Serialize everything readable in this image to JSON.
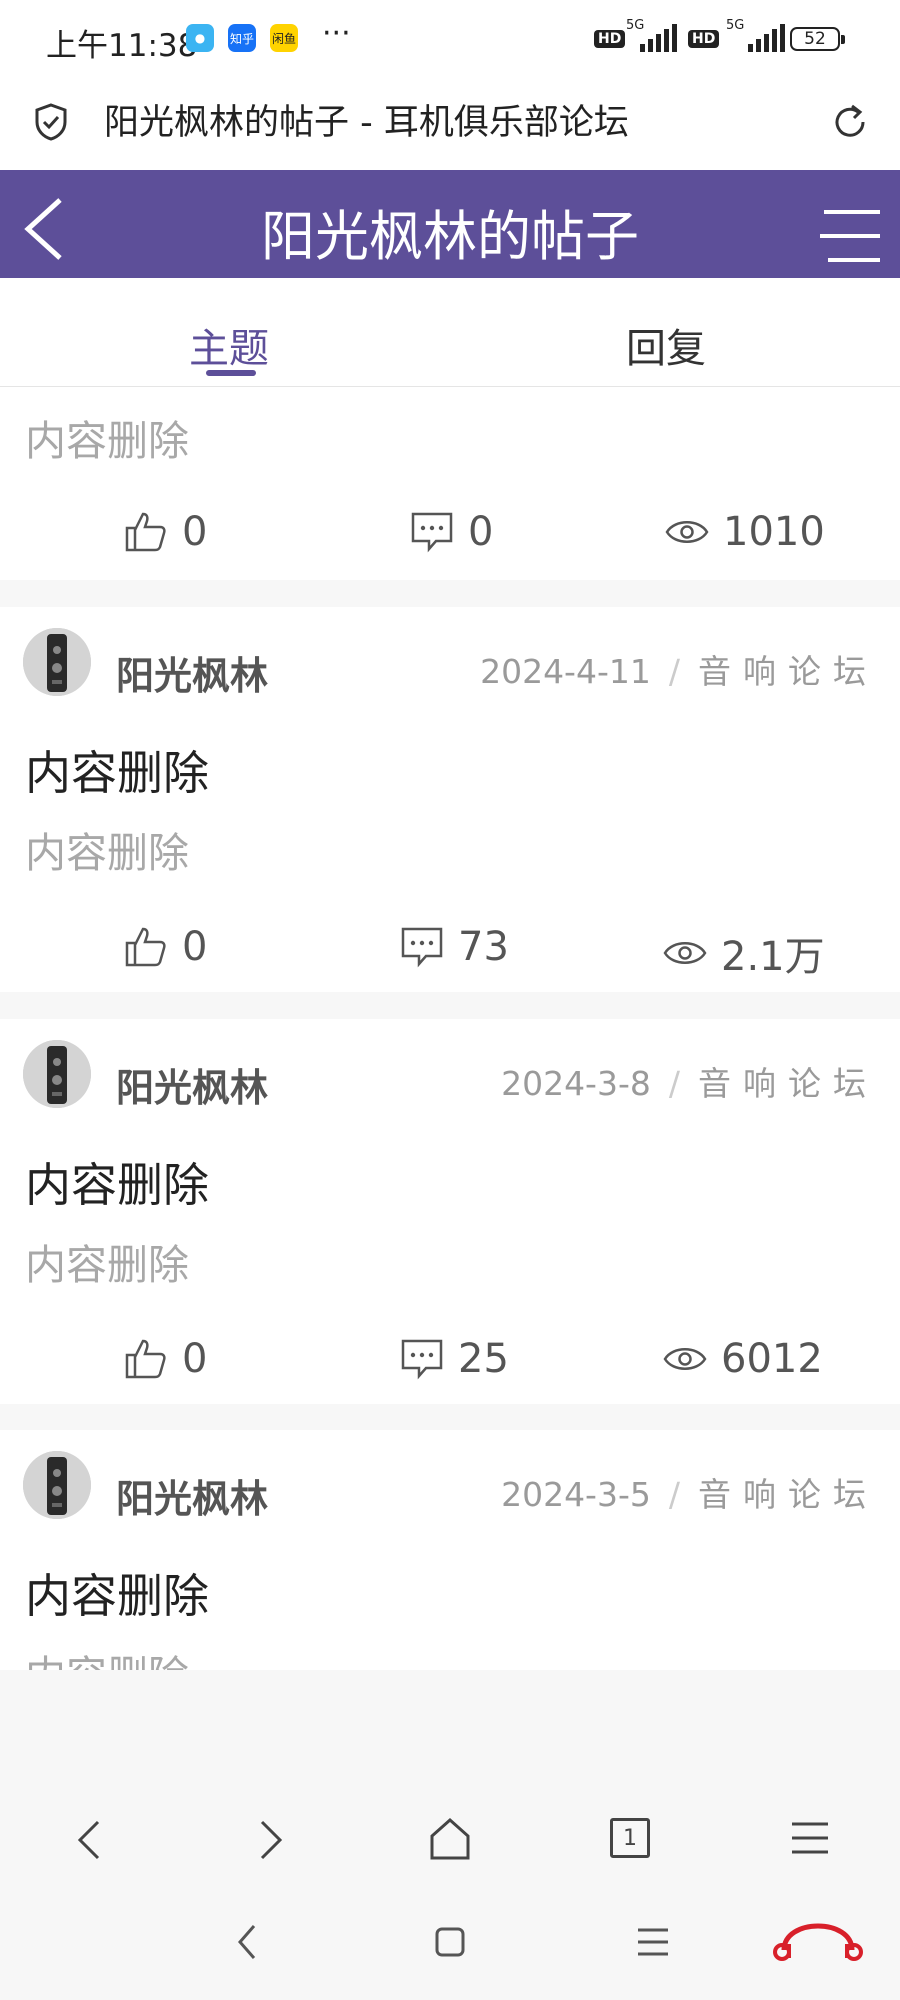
{
  "status_bar": {
    "time": "上午11:38",
    "apps": [
      "知乎",
      "闲鱼"
    ],
    "more": "···",
    "hd": "HD",
    "network": "5G",
    "battery": "52"
  },
  "browser": {
    "page_title": "阳光枫林的帖子 - 耳机俱乐部论坛"
  },
  "header": {
    "title": "阳光枫林的帖子"
  },
  "tabs": [
    {
      "label": "主题",
      "active": true
    },
    {
      "label": "回复",
      "active": false
    }
  ],
  "posts": [
    {
      "excerpt": "内容删除",
      "likes": "0",
      "comments": "0",
      "views": "1010"
    },
    {
      "author": "阳光枫林",
      "date": "2024-4-11",
      "forum": "音响论坛",
      "title": "内容删除",
      "excerpt": "内容删除",
      "likes": "0",
      "comments": "73",
      "views": "2.1万"
    },
    {
      "author": "阳光枫林",
      "date": "2024-3-8",
      "forum": "音响论坛",
      "title": "内容删除",
      "excerpt": "内容删除",
      "likes": "0",
      "comments": "25",
      "views": "6012"
    },
    {
      "author": "阳光枫林",
      "date": "2024-3-5",
      "forum": "音响论坛",
      "title": "内容删除",
      "excerpt": "内容删除"
    }
  ],
  "browser_nav": {
    "tab_count": "1"
  },
  "colors": {
    "accent": "#5d4f99",
    "muted_text": "#a8a8a8",
    "logo_red": "#d8202a"
  }
}
